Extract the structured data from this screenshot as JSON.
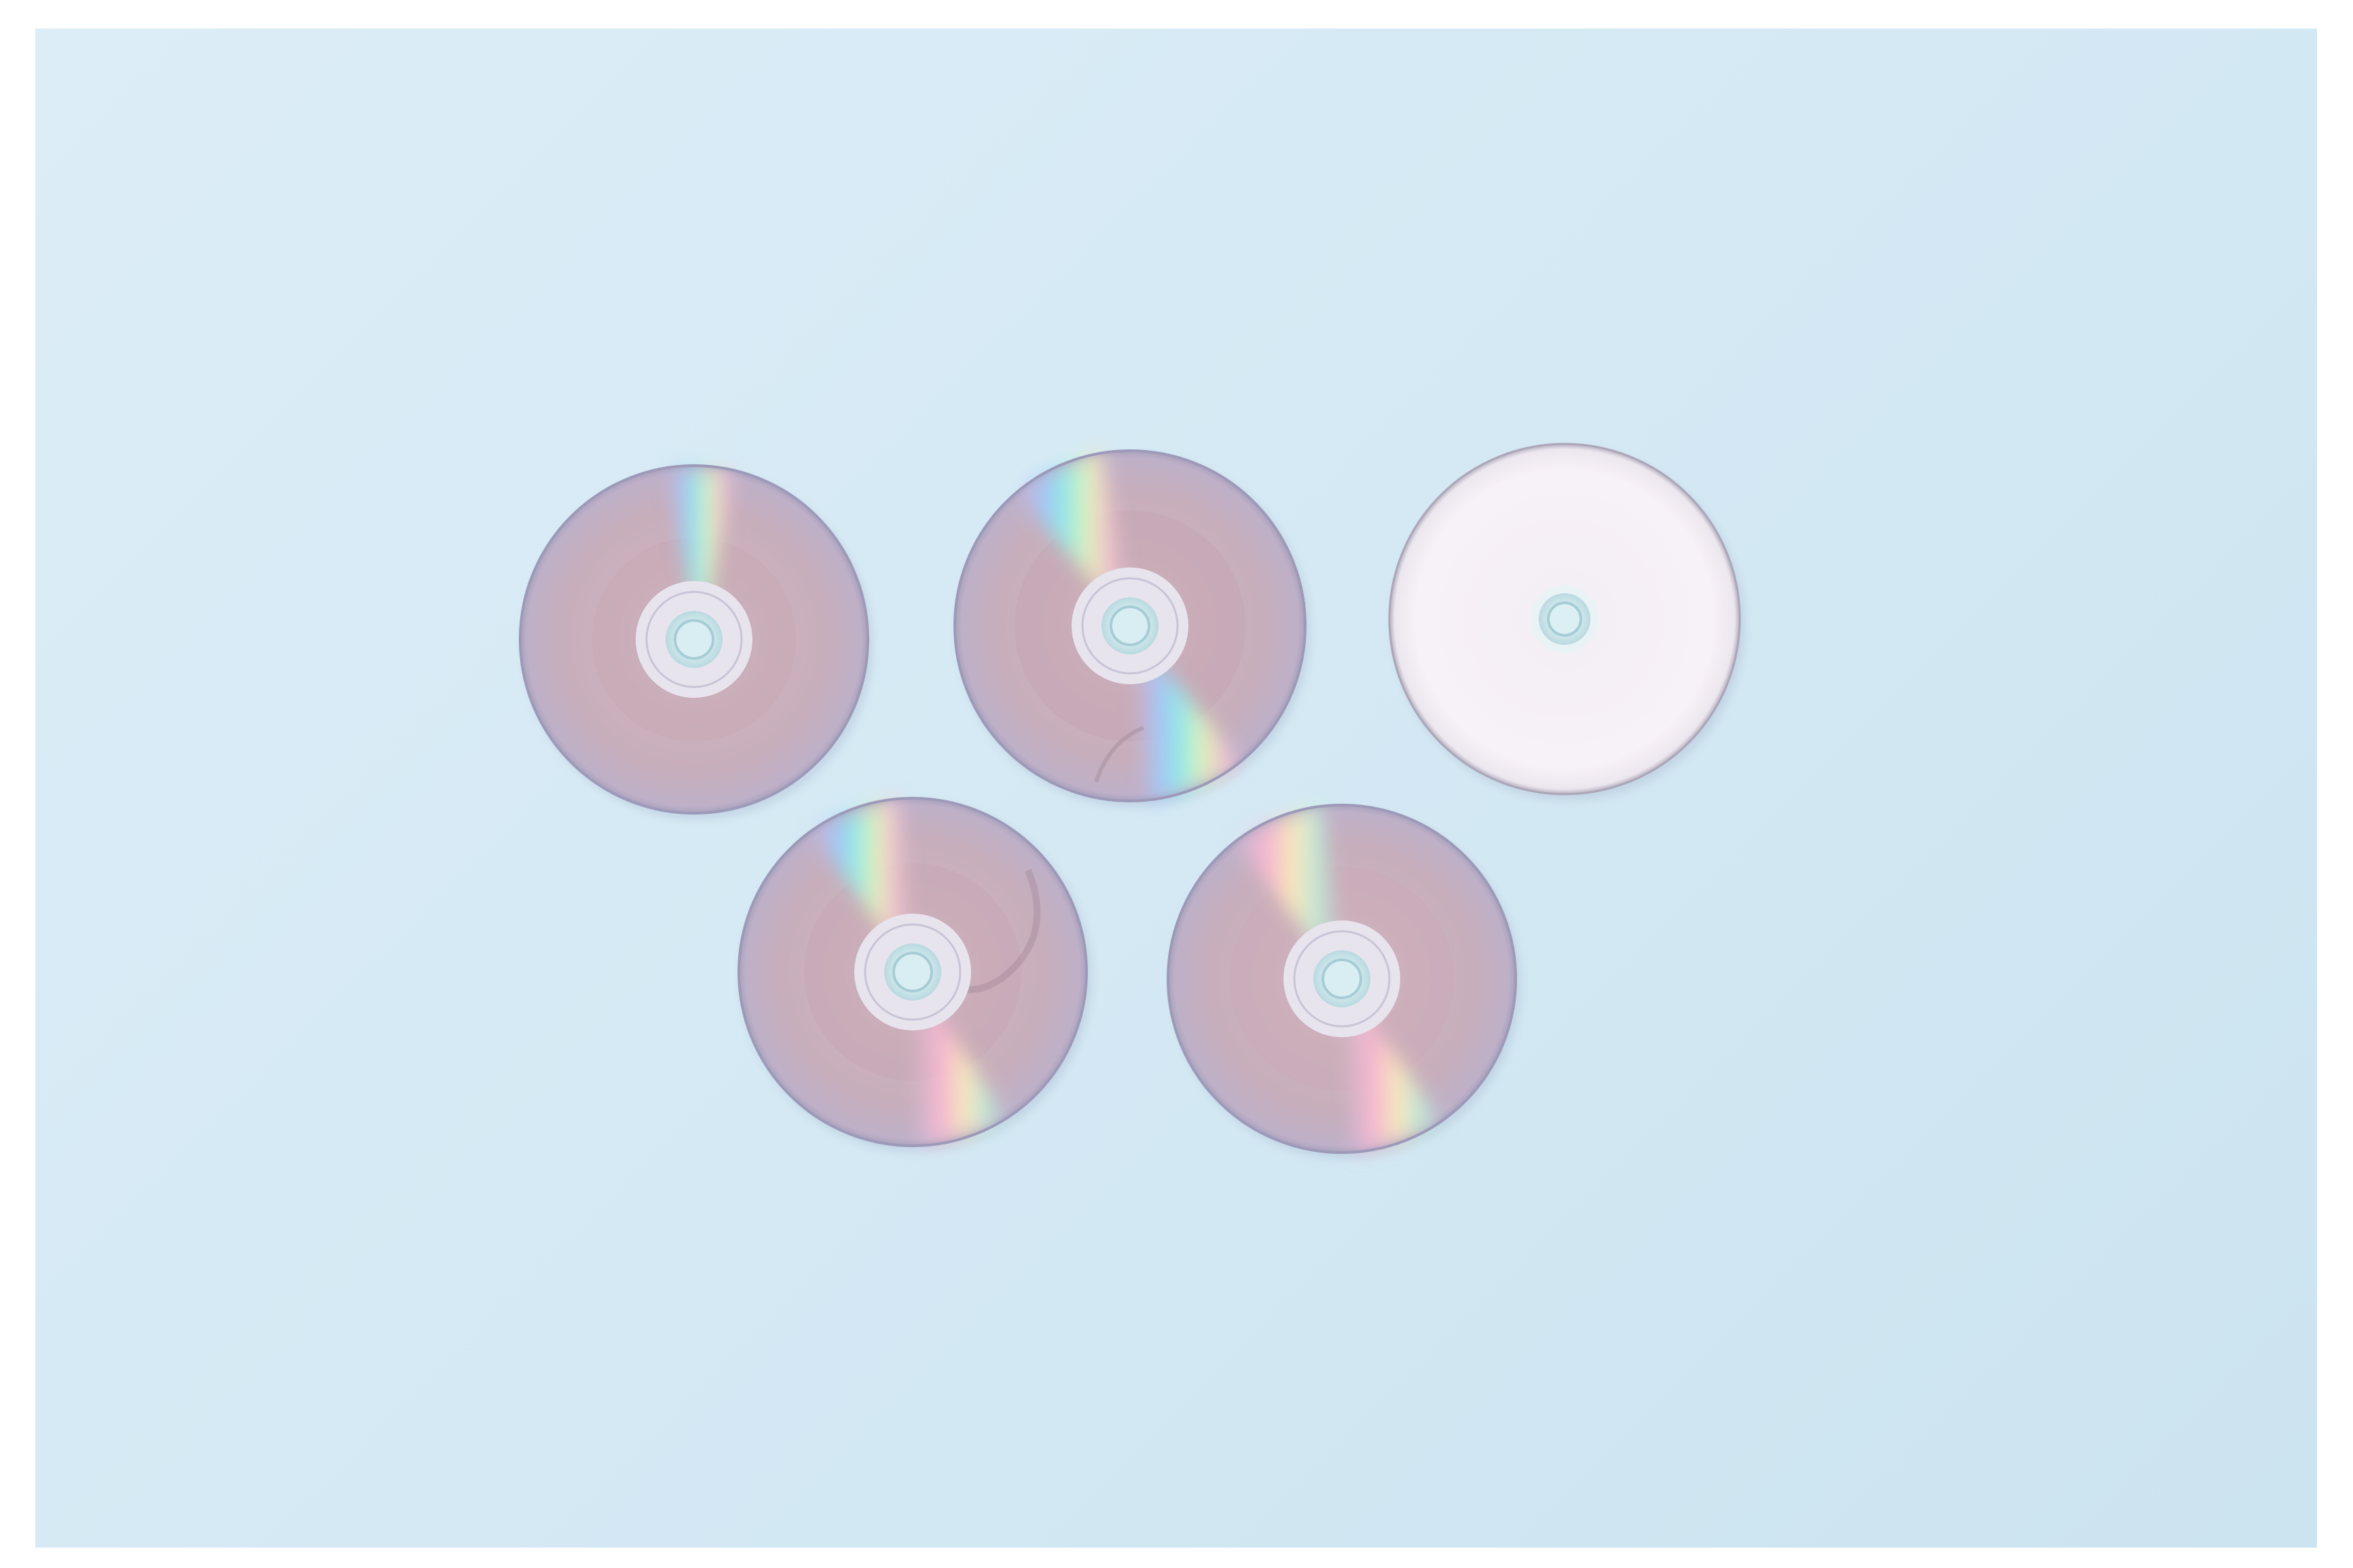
{
  "scene": {
    "subject": "optical discs",
    "colors": {
      "border": "#ffffff",
      "background": "#d4e9f4",
      "disc_silver": "#c8b6c4",
      "disc_printable": "#f7f3f7",
      "hub": "#cfe6ee"
    },
    "discs": [
      {
        "kind": "data-side",
        "row": 1,
        "col": 1
      },
      {
        "kind": "data-side",
        "row": 1,
        "col": 2
      },
      {
        "kind": "printable-label-side",
        "row": 1,
        "col": 3
      },
      {
        "kind": "data-side",
        "row": 2,
        "col": 1
      },
      {
        "kind": "data-side",
        "row": 2,
        "col": 2
      }
    ]
  }
}
